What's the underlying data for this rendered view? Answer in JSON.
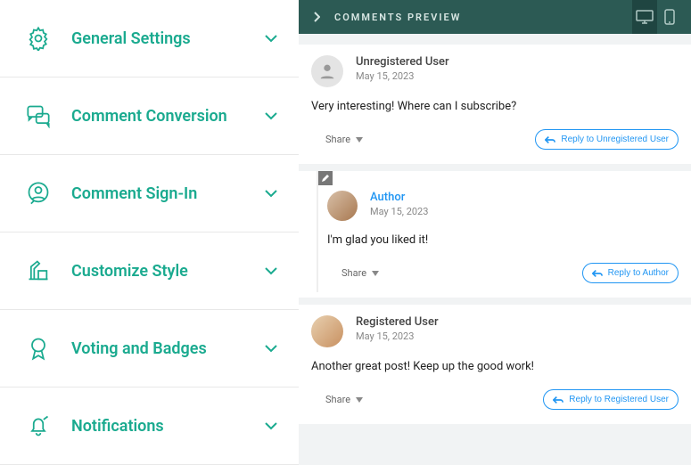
{
  "sidebar": {
    "items": [
      {
        "label": "General Settings"
      },
      {
        "label": "Comment Conversion"
      },
      {
        "label": "Comment Sign-In"
      },
      {
        "label": "Customize Style"
      },
      {
        "label": "Voting and Badges"
      },
      {
        "label": "Notifications"
      }
    ]
  },
  "preview": {
    "header_title": "COMMENTS PREVIEW",
    "comments": [
      {
        "user": "Unregistered User",
        "date": "May 15, 2023",
        "body": "Very interesting! Where can I subscribe?",
        "share_label": "Share",
        "reply_label": "Reply to Unregistered User",
        "replies": [
          {
            "user": "Author",
            "date": "May 15, 2023",
            "body": "I'm glad you liked it!",
            "share_label": "Share",
            "reply_label": "Reply to Author"
          }
        ]
      },
      {
        "user": "Registered User",
        "date": "May 15, 2023",
        "body": "Another great post! Keep up the good work!",
        "share_label": "Share",
        "reply_label": "Reply to Registered User"
      }
    ]
  }
}
